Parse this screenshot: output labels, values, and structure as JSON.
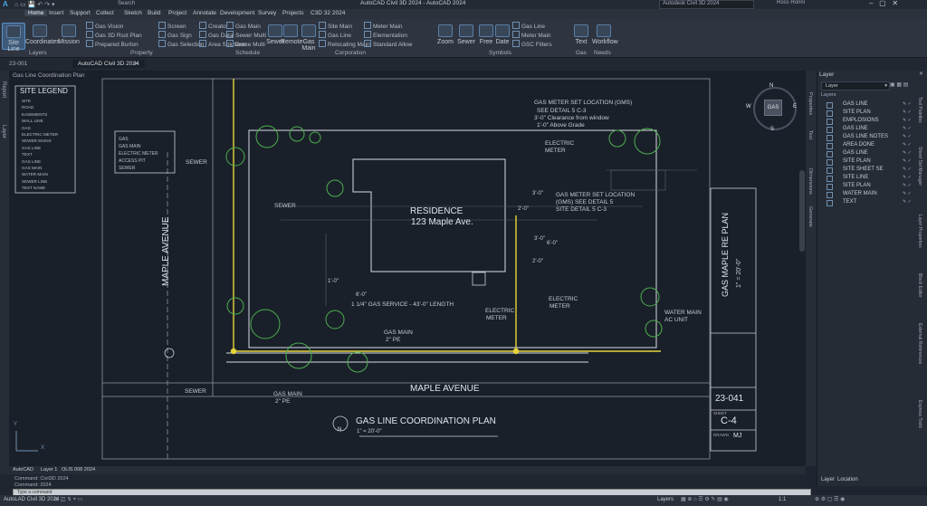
{
  "app": {
    "title": "AutoCAD Civil 3D 2024 - AutoCAD 2024",
    "search_label": "Autodesk Civil 3D 2024",
    "user_label": "Ross Ronni",
    "brand_letter": "A",
    "quick_access_label": "Search"
  },
  "menu_tabs": [
    "Home",
    "Insert",
    "Support",
    "Collect",
    "Sketch",
    "Build",
    "Project",
    "Annotate",
    "Development",
    "Survey",
    "Projects",
    "C3D 32 2024"
  ],
  "ribbon": {
    "big_buttons": [
      {
        "label": "Site Line",
        "icon": "site-line-icon"
      },
      {
        "label": "Coordinates",
        "icon": "coordinates-icon"
      },
      {
        "label": "Mission",
        "icon": "mission-icon"
      }
    ],
    "col1": [
      "Gas Vision",
      "Gas 3D Rsst Plan",
      "Prepared Burton"
    ],
    "col2": [
      "Screen",
      "Gas Sign",
      "Gas Selection"
    ],
    "col3": [
      "Creator",
      "Gas Data",
      "Area Solutions"
    ],
    "col4": [
      "Gas Main",
      "Sewer Multi",
      "Dome Multi"
    ],
    "sched_big": [
      "Sewer",
      "Remote",
      "Gas Main"
    ],
    "col5": [
      "Site Main",
      "Gas Line",
      "Relocating Main"
    ],
    "col6": [
      "Meter Main",
      "Elementation",
      "Standard Allow"
    ],
    "col7": [
      "Zoom",
      "Sewer",
      "Free",
      "Date",
      "Radius"
    ],
    "col8": [
      "Gas Line",
      "Meter Main",
      "GSC Filters"
    ],
    "text_btn": "Text",
    "workflow_btn": "Workflow",
    "groups": [
      "Layers",
      "Property",
      "Schedule",
      "Corporation",
      "Symbols",
      "Gas",
      "Needs"
    ]
  },
  "file_tabs": [
    "23-001",
    "AutoCAD Civil 3D 2024"
  ],
  "view_label": "Gas Line Coordination Plan",
  "left_vtabs": [
    "Report",
    "Layer"
  ],
  "drawing": {
    "legend_title": "SITE LEGEND",
    "legend_items": [
      "SITE",
      "ROAD",
      "EASEMENTS",
      "WALL LINE",
      "GAS",
      "ELECTRIC METER",
      "SEWER MAINS",
      "GAS LINE",
      "TEXT",
      "GAS LINE",
      "GAS MAIN",
      "WATER MAIN",
      "SEWER LINE",
      "TEXT NAME"
    ],
    "small_legend": [
      "GAS",
      "GAS MAIN",
      "ELECTRIC METER",
      "ACCESS PIT",
      "SEWER"
    ],
    "residence_title": "RESIDENCE",
    "residence_address": "123 Maple Ave.",
    "meter_note_1": "GAS METER SET LOCATION (GMS)",
    "meter_note_2": "SEE DETAIL 5 C-3",
    "meter_note_3": "3'-0\" Clearance from window",
    "meter_note_4": "1'-0\" Above Grade",
    "electric_meter": "ELECTRIC",
    "meter_word": "METER",
    "meter_set_1": "GAS METER SET LOCATION",
    "meter_set_2": "(GMS) SEE DETAIL 5",
    "meter_set_3": "SITE DETAIL 5 C-3",
    "dim_30": "3'-0\"",
    "dim_20": "2'-0\"",
    "dim_36": "3'-0\"",
    "dim_60": "6'-0\"",
    "dim_24": "2'-0\"",
    "dim_10": "1'-0\"",
    "dim_60b": "6'-0\"",
    "gas_service": "1 1/4\" GAS SERVICE - 43'-0\" LENGTH",
    "electric_meter_2": "ELECTRIC",
    "electric_meter_3": "ELECTRIC",
    "gas_main_label": "GAS MAIN",
    "gas_main_size": "2\" PE",
    "gas_main_label2": "GAS MAIN",
    "gas_main_size2": "2\" PE",
    "water_main": "WATER MAIN",
    "ac_unit": "AC UNIT",
    "sewer_1": "SEWER",
    "sewer_2": "SEWER",
    "sewer_3": "SEWER",
    "maple_left": "MAPLE AVENUE",
    "maple_bottom": "MAPLE AVENUE",
    "plan_title": "GAS LINE COORDINATION PLAN",
    "plan_scale": "1\" = 20'-0\"",
    "north": "N",
    "title_block_name": "GAS MAPLE RE PLAN",
    "title_block_scale": "1\" = 20'-0\"",
    "sheet_no": "23-041",
    "sheet_code": "C-4",
    "drawn_by": "MJ",
    "sheet_label": "SHEET",
    "drawn_label": "DRAWN"
  },
  "viewcube": {
    "label": "GAS",
    "n": "N",
    "s": "S",
    "e": "E",
    "w": "W"
  },
  "layer_panel": {
    "title": "Layer",
    "dropdown": "Layer",
    "layers_label": "Layers",
    "rows": [
      "GAS LINE",
      "SITE PLAN",
      "EMPLOSIONS",
      "GAS LINE",
      "GAS LINE NOTES",
      "AREA DONE",
      "GAS LINE",
      "SITE PLAN",
      "SITE SHEET SE",
      "SITE LINE",
      "SITE PLAN",
      "WATER MAIN",
      "TEXT"
    ],
    "bottom_tabs": [
      "Layer",
      "Location"
    ]
  },
  "right_vtabs_a": [
    "Properties",
    "Text",
    "Dimensions",
    "Generate"
  ],
  "right_vtabs_b": [
    "Tool Palettes",
    "Sheet Set Manager",
    "Layer Properties",
    "Block Editor",
    "External References",
    "Express Tools"
  ],
  "layout_tabs": [
    "AutoCAD",
    "Layer 1",
    "OLIS 008 2024"
  ],
  "command": {
    "line1": "Command: Civil3D 2024",
    "line2": "Command: 2024",
    "input": "Type a command"
  },
  "status_bar": {
    "left": "AutoLAD Civil 3D 2024",
    "middle": "Layers",
    "right": "1:1"
  },
  "colors": {
    "accent": "#4aa3df",
    "gas": "#e6d43a",
    "tree": "#4caf50",
    "linework": "#d8dde4"
  }
}
